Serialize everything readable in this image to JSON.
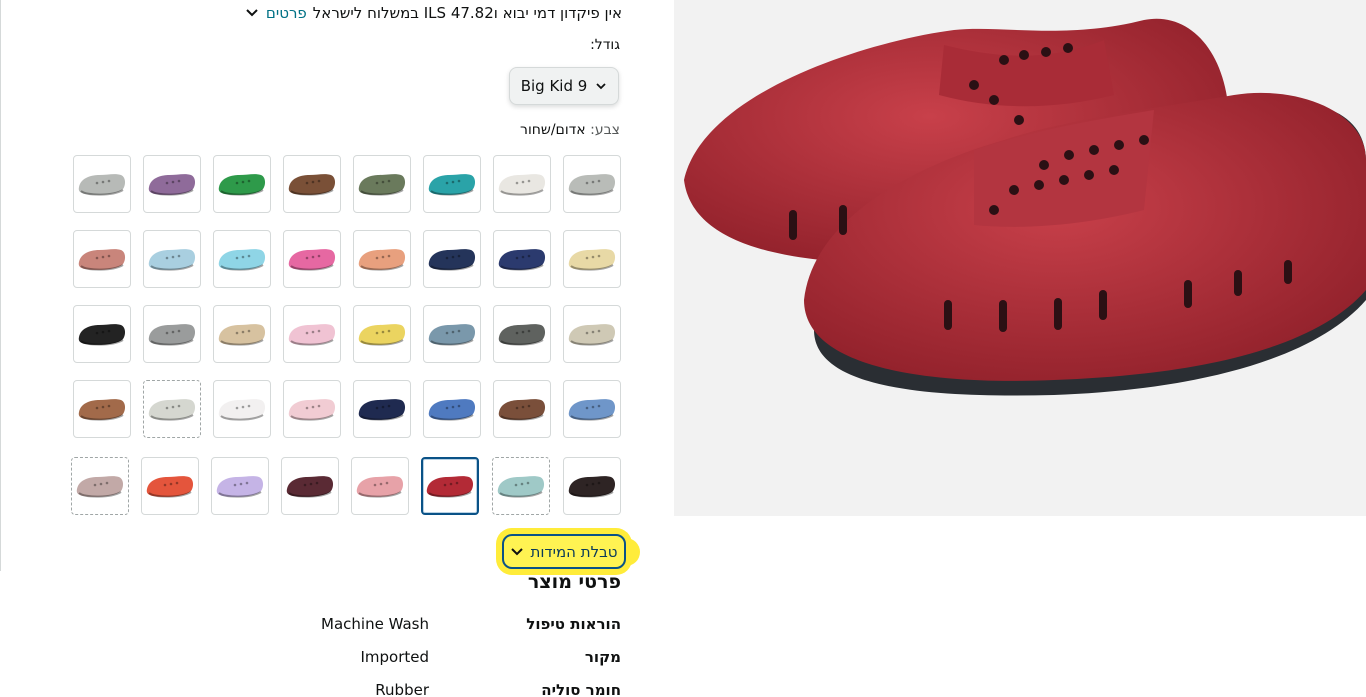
{
  "shipping": {
    "text": "אין פיקדון דמי יבוא ו‎ILS 47.82 במשלוח לישראל",
    "details_link": "פרטים"
  },
  "size": {
    "label": "גודל:",
    "selected_value": "Big Kid 9"
  },
  "color": {
    "label": "צבע:",
    "selected_value": "אדום/שחור"
  },
  "swatches": {
    "row1": [
      "#b9bcb8",
      "#e9e7e2",
      "#2aa3a8",
      "#6a7a5c",
      "#7a5037",
      "#2e9a4a",
      "#8f6b9a",
      "#b7bab7"
    ],
    "row2": [
      "#e8d9a6",
      "#2b3a6e",
      "#24345a",
      "#e8a07e",
      "#e668a2",
      "#8fd5e6",
      "#a9cfe0",
      "#c9857b"
    ],
    "row3": [
      "#cfc9b5",
      "#5f625f",
      "#7a98ab",
      "#ebd460",
      "#f0c3d3",
      "#d7c2a0",
      "#9a9c9c",
      "#232323"
    ],
    "row4": [
      "#6f96c9",
      "#7a4f3a",
      "#4f7ac0",
      "#1f2a50",
      "#f1ccd3",
      "#f2f0f0",
      "#d5d7d0",
      "#a26a4a"
    ],
    "row5": [
      "#2e2424",
      "#9fc9c7",
      "#b32a36",
      "#e7a2a8",
      "#5a2a34",
      "#c5b4e6",
      "#e4553c",
      "#c2a9a7"
    ]
  },
  "size_chart": {
    "label": "טבלת המידות"
  },
  "details": {
    "title": "פרטי מוצר",
    "rows": [
      {
        "key": "הוראות טיפול",
        "value": "Machine Wash"
      },
      {
        "key": "מקור",
        "value": "Imported"
      },
      {
        "key": "חומר סוליה",
        "value": "Rubber"
      }
    ]
  },
  "image": {
    "main_color": "#b3303b"
  }
}
